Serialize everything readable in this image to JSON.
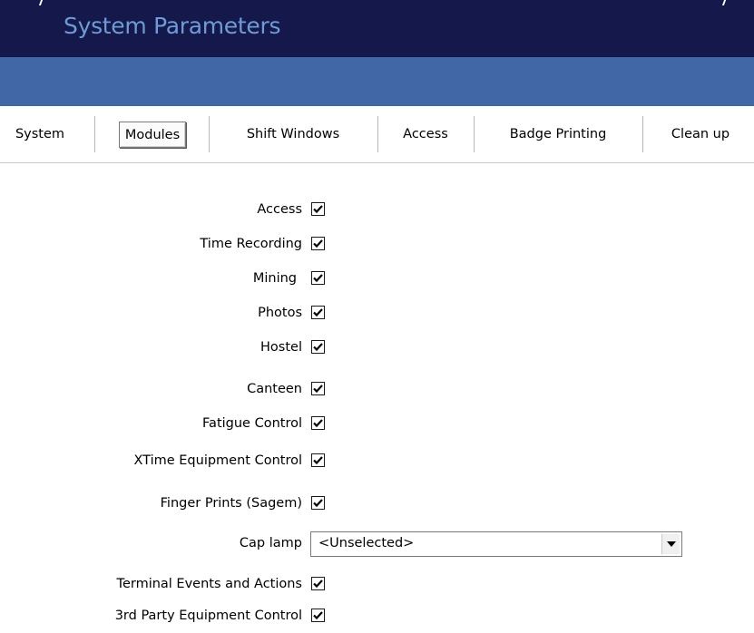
{
  "window": {
    "title": "System Parameters"
  },
  "tabs": [
    {
      "label": "System",
      "active": false
    },
    {
      "label": "Modules",
      "active": true
    },
    {
      "label": "Shift Windows",
      "active": false
    },
    {
      "label": "Access",
      "active": false
    },
    {
      "label": "Badge Printing",
      "active": false
    },
    {
      "label": "Clean up",
      "active": false
    }
  ],
  "modules": {
    "access": {
      "label": "Access",
      "checked": true
    },
    "time_recording": {
      "label": "Time Recording",
      "checked": true
    },
    "mining": {
      "label": "Mining",
      "checked": true
    },
    "photos": {
      "label": "Photos",
      "checked": true
    },
    "hostel": {
      "label": "Hostel",
      "checked": true
    },
    "canteen": {
      "label": "Canteen",
      "checked": true
    },
    "fatigue_control": {
      "label": "Fatigue Control",
      "checked": true
    },
    "xtime_equipment_control": {
      "label": "XTime Equipment Control",
      "checked": true
    },
    "finger_prints": {
      "label": "Finger Prints (Sagem)",
      "checked": true
    },
    "cap_lamp": {
      "label": "Cap lamp",
      "selected_value": "<Unselected>"
    },
    "terminal_events": {
      "label": "Terminal Events and Actions",
      "checked": true
    },
    "third_party_equipment": {
      "label": "3rd Party Equipment Control",
      "checked": true
    }
  },
  "icons": {
    "checkmark": "check-icon",
    "dropdown": "chevron-down-icon"
  },
  "colors": {
    "title_bar": "#14184a",
    "title_text": "#6e9bd6",
    "band": "#4167a6"
  }
}
